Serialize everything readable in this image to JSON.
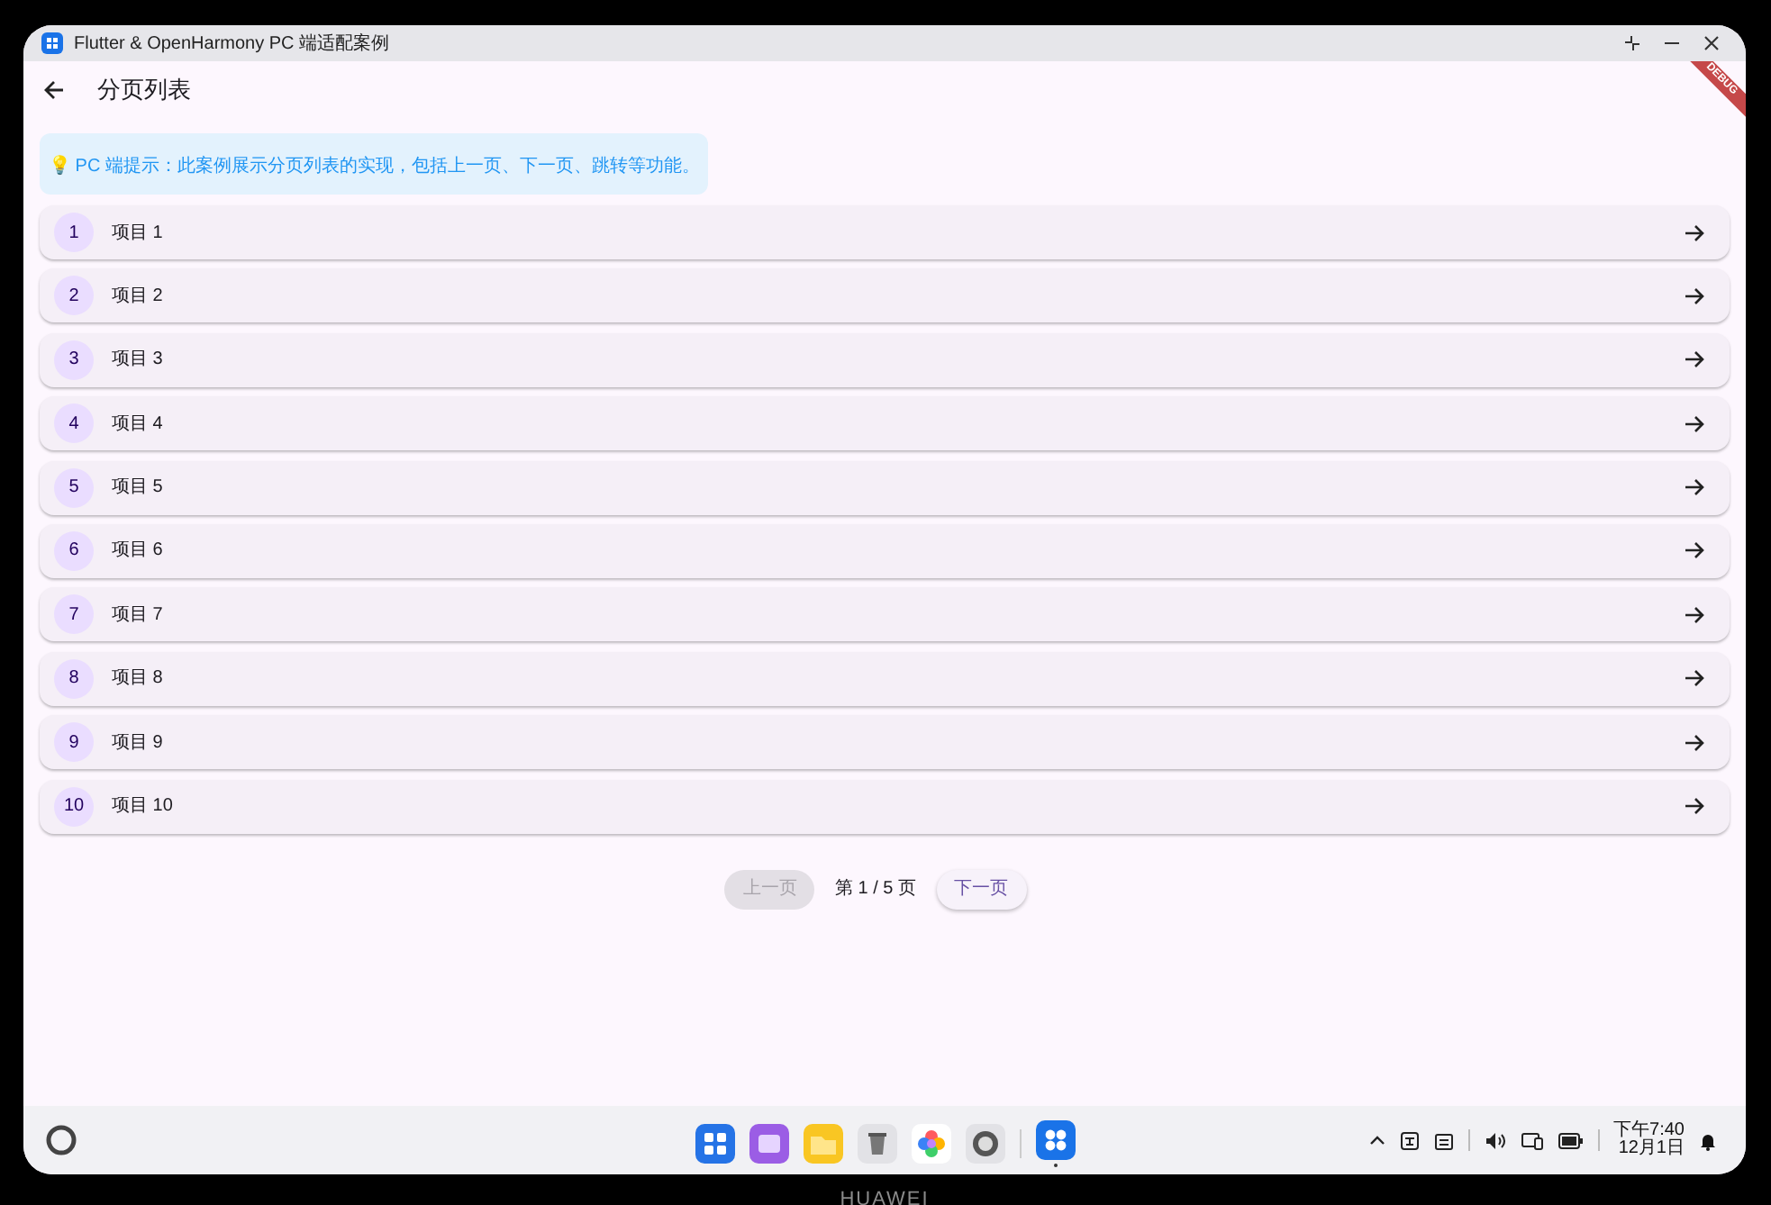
{
  "window": {
    "title": "Flutter & OpenHarmony PC 端适配案例"
  },
  "app_bar": {
    "title": "分页列表"
  },
  "debug_banner": "DEBUG",
  "tip": "💡 PC 端提示：此案例展示分页列表的实现，包括上一页、下一页、跳转等功能。",
  "items": [
    {
      "number": "1",
      "label": "项目 1"
    },
    {
      "number": "2",
      "label": "项目 2"
    },
    {
      "number": "3",
      "label": "项目 3"
    },
    {
      "number": "4",
      "label": "项目 4"
    },
    {
      "number": "5",
      "label": "项目 5"
    },
    {
      "number": "6",
      "label": "项目 6"
    },
    {
      "number": "7",
      "label": "项目 7"
    },
    {
      "number": "8",
      "label": "项目 8"
    },
    {
      "number": "9",
      "label": "项目 9"
    },
    {
      "number": "10",
      "label": "项目 10"
    }
  ],
  "pagination": {
    "previous": {
      "label": "上一页",
      "disabled": true
    },
    "page_info": "第 1 / 5 页",
    "next": {
      "label": "下一页",
      "disabled": false
    }
  },
  "taskbar": {
    "time": "下午7:40",
    "date": "12月1日"
  },
  "device": {
    "brand": "HUAWEI"
  }
}
